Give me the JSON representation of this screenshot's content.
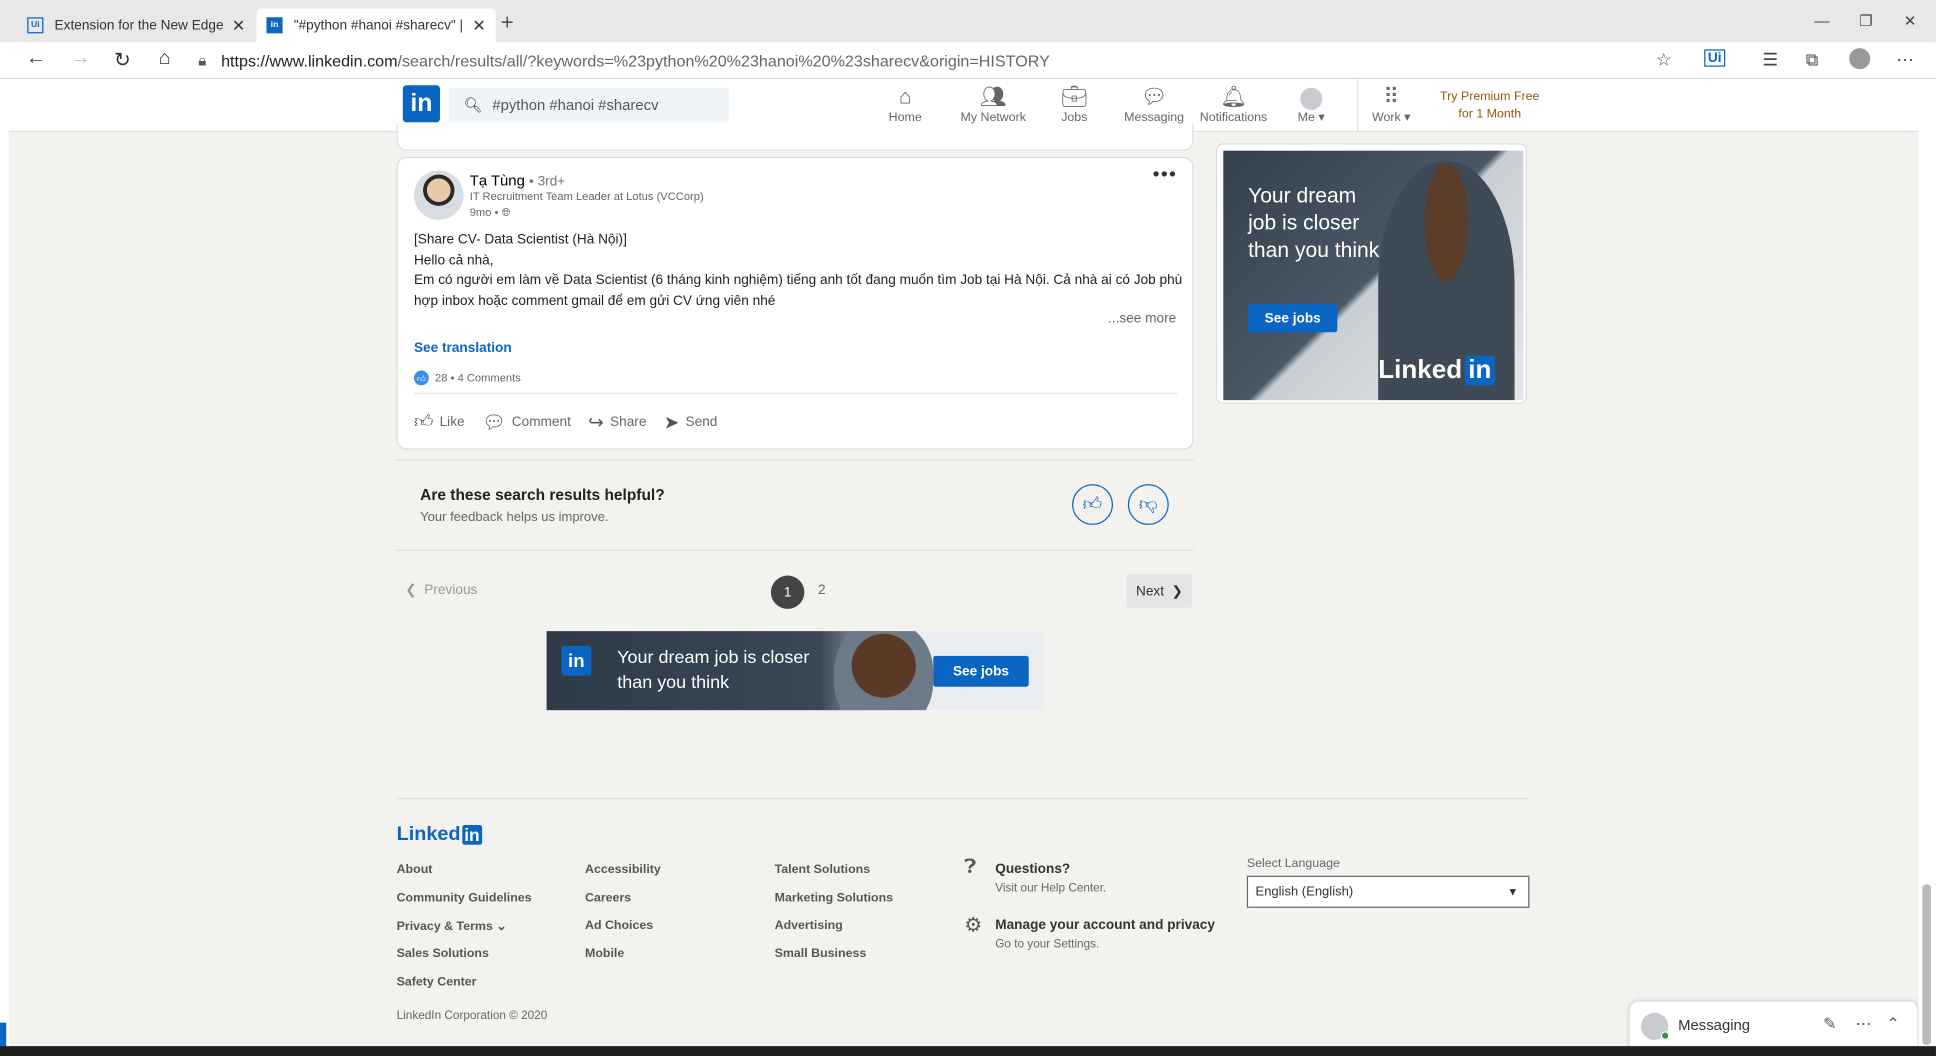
{
  "browser": {
    "tabs": [
      {
        "label": "Extension for the New Edge Brow",
        "favicon": "Ui"
      },
      {
        "label": "\"#python #hanoi #sharecv\" | Sea",
        "favicon": "in"
      }
    ],
    "url_host": "https://www.linkedin.com",
    "url_path": "/search/results/all/?keywords=%23python%20%23hanoi%20%23sharecv&origin=HISTORY"
  },
  "nav": {
    "search_value": "#python #hanoi #sharecv",
    "items": [
      "Home",
      "My Network",
      "Jobs",
      "Messaging",
      "Notifications",
      "Me",
      "Work"
    ],
    "premium_line1": "Try Premium Free",
    "premium_line2": "for 1 Month"
  },
  "post": {
    "author": "Tạ Tùng",
    "degree": "• 3rd+",
    "headline": "IT Recruitment Team Leader at Lotus (VCCorp)",
    "time": "9mo •",
    "text_line1": "[Share CV- Data Scientist (Hà Nội)]",
    "text_line2": "Hello cả nhà,",
    "text_line3": "Em có người em làm về Data Scientist (6 tháng kinh nghiệm) tiếng anh tốt đang muốn tìm Job tại Hà Nội. Cả nhà ai có Job phù hợp inbox hoặc comment gmail để em gửi CV ứng viên nhé",
    "see_more": "...see more",
    "see_translation": "See translation",
    "reactions": "28",
    "comments": "• 4 Comments",
    "actions": [
      "Like",
      "Comment",
      "Share",
      "Send"
    ]
  },
  "feedback": {
    "question": "Are these search results helpful?",
    "sub": "Your feedback helps us improve."
  },
  "pagination": {
    "previous": "Previous",
    "current": "1",
    "page2": "2",
    "next": "Next"
  },
  "banner_ad": {
    "text": "Your dream job is closer than you think",
    "button": "See jobs"
  },
  "side_ad": {
    "text": "Your dream job is closer than you think",
    "button": "See jobs",
    "logo_word": "Linked",
    "logo_box": "in"
  },
  "footer": {
    "logo_word": "Linked",
    "logo_box": "in",
    "col1": [
      "About",
      "Community Guidelines",
      "Privacy & Terms",
      "Sales Solutions",
      "Safety Center"
    ],
    "col2": [
      "Accessibility",
      "Careers",
      "Ad Choices",
      "Mobile"
    ],
    "col3": [
      "Talent Solutions",
      "Marketing Solutions",
      "Advertising",
      "Small Business"
    ],
    "help1_title": "Questions?",
    "help1_sub": "Visit our Help Center.",
    "help2_title": "Manage your account and privacy",
    "help2_sub": "Go to your Settings.",
    "lang_label": "Select Language",
    "lang_value": "English (English)",
    "copyright": "LinkedIn Corporation © 2020"
  },
  "messaging": {
    "label": "Messaging"
  },
  "colors": {
    "brand": "#0a66c2",
    "premium": "#915907",
    "background": "#f3f2ef"
  }
}
